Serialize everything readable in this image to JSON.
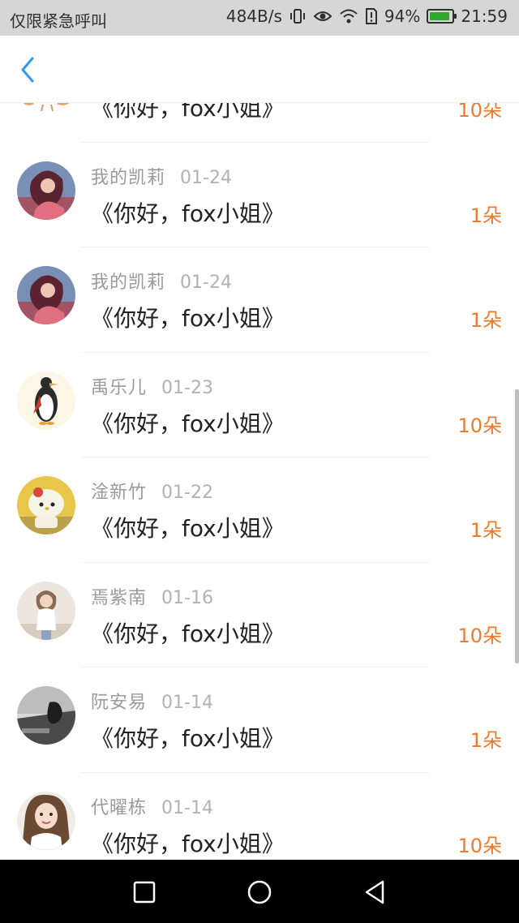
{
  "status_bar": {
    "carrier": "仅限紧急呼叫",
    "speed": "484B/s",
    "battery": "94%",
    "battery_level": 0.94,
    "time": "21:59",
    "icons": [
      "vibrate-icon",
      "eye-icon",
      "wifi-icon",
      "sim-icon",
      "battery-icon"
    ]
  },
  "header": {
    "back_icon": "chevron-left-icon",
    "accent": "#2b9bf0"
  },
  "list": {
    "amount_color": "#f07a2a",
    "items": [
      {
        "name": "",
        "date": "",
        "gift": "《你好，fox小姐》",
        "amount": "10朵"
      },
      {
        "name": "我的凯莉",
        "date": "01-24",
        "gift": "《你好，fox小姐》",
        "amount": "1朵"
      },
      {
        "name": "我的凯莉",
        "date": "01-24",
        "gift": "《你好，fox小姐》",
        "amount": "1朵"
      },
      {
        "name": "禹乐儿",
        "date": "01-23",
        "gift": "《你好，fox小姐》",
        "amount": "10朵"
      },
      {
        "name": "淦新竹",
        "date": "01-22",
        "gift": "《你好，fox小姐》",
        "amount": "1朵"
      },
      {
        "name": "焉紫南",
        "date": "01-16",
        "gift": "《你好，fox小姐》",
        "amount": "10朵"
      },
      {
        "name": "阮安易",
        "date": "01-14",
        "gift": "《你好，fox小姐》",
        "amount": "1朵"
      },
      {
        "name": "代曜栋",
        "date": "01-14",
        "gift": "《你好，fox小姐》",
        "amount": "10朵"
      }
    ]
  },
  "nav_bar": {
    "recent_icon": "square-recent-icon",
    "home_icon": "circle-home-icon",
    "back_icon": "triangle-back-icon"
  }
}
